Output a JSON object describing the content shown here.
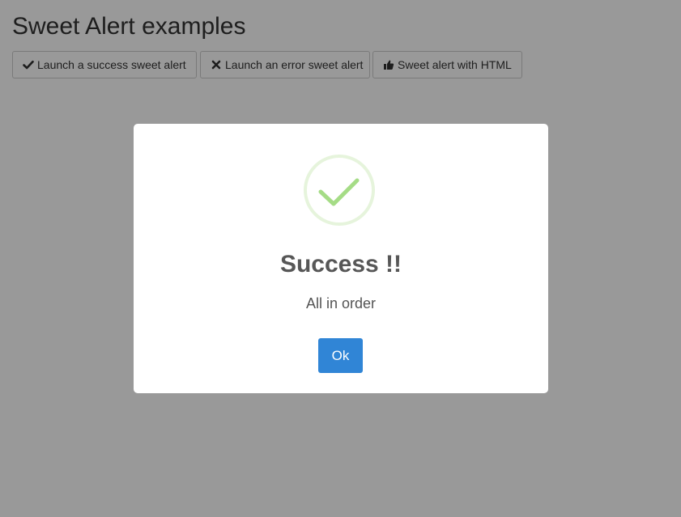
{
  "page": {
    "title": "Sweet Alert examples",
    "buttons": [
      {
        "label": "Launch a success sweet alert",
        "icon": "check-icon"
      },
      {
        "label": "Launch an error sweet alert",
        "icon": "times-icon"
      },
      {
        "label": "Sweet alert with HTML",
        "icon": "thumbs-up-icon"
      }
    ]
  },
  "modal": {
    "icon": "success-checkmark-icon",
    "title": "Success !!",
    "text": "All in order",
    "confirm_label": "Ok"
  },
  "colors": {
    "overlay": "rgba(0,0,0,0.4)",
    "confirm_button": "#3085d6",
    "success_check": "#a5dc86",
    "success_ring": "#e6f4dc"
  }
}
